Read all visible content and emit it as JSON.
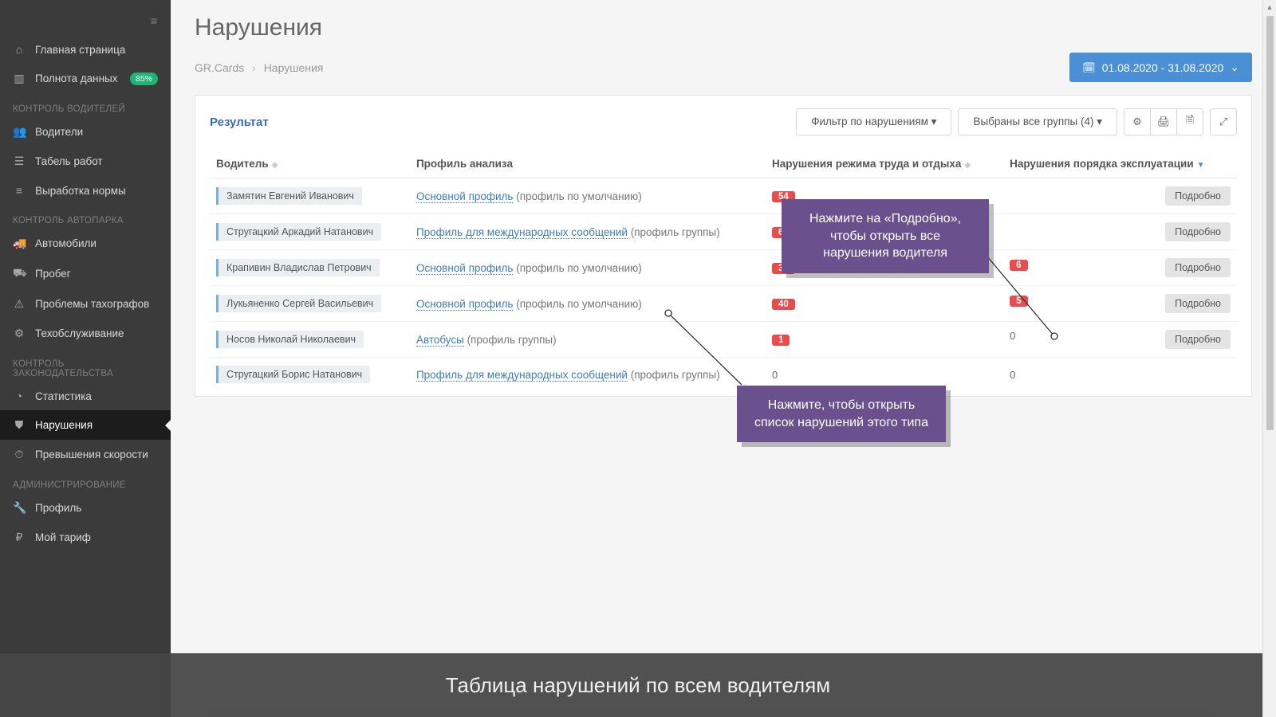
{
  "sidebar": {
    "items": [
      {
        "icon": "⌂",
        "label": "Главная страница"
      },
      {
        "icon": "▥",
        "label": "Полнота данных",
        "badge": "85%"
      }
    ],
    "groups": [
      {
        "title": "КОНТРОЛЬ ВОДИТЕЛЕЙ",
        "items": [
          {
            "icon": "👥",
            "label": "Водители"
          },
          {
            "icon": "☰",
            "label": "Табель работ"
          },
          {
            "icon": "≡",
            "label": "Выработка нормы"
          }
        ]
      },
      {
        "title": "КОНТРОЛЬ АВТОПАРКА",
        "items": [
          {
            "icon": "🚚",
            "label": "Автомобили"
          },
          {
            "icon": "⛟",
            "label": "Пробег"
          },
          {
            "icon": "⚠",
            "label": "Проблемы тахографов"
          },
          {
            "icon": "⚙",
            "label": "Техобслуживание"
          }
        ]
      },
      {
        "title": "КОНТРОЛЬ ЗАКОНОДАТЕЛЬСТВА",
        "items": [
          {
            "icon": "◔",
            "label": "Статистика"
          },
          {
            "icon": "⛊",
            "label": "Нарушения",
            "active": true
          },
          {
            "icon": "⏱",
            "label": "Превышения скорости"
          }
        ]
      },
      {
        "title": "АДМИНИСТРИРОВАНИЕ",
        "items": [
          {
            "icon": "🔧",
            "label": "Профиль"
          },
          {
            "icon": "₽",
            "label": "Мой тариф"
          }
        ]
      }
    ]
  },
  "page": {
    "title": "Нарушения",
    "breadcrumb_root": "GR.Cards",
    "breadcrumb_current": "Нарушения",
    "date_range": "01.08.2020 -  31.08.2020"
  },
  "panel": {
    "title": "Результат",
    "filter_btn": "Фильтр по нарушениям",
    "groups_btn": "Выбраны все группы (4)"
  },
  "table": {
    "headers": {
      "driver": "Водитель",
      "profile": "Профиль анализа",
      "violations_work": "Нарушения режима труда и отдыха",
      "violations_exp": "Нарушения порядка эксплуатации"
    },
    "rows": [
      {
        "driver": "Замятин Евгений Иванович",
        "profile_link": "Основной профиль",
        "profile_suffix": " (профиль по умолчанию)",
        "v1": "54",
        "v2": "",
        "detail": "Подробно"
      },
      {
        "driver": "Стругацкий Аркадий Натанович",
        "profile_link": "Профиль для международных сообщений",
        "profile_suffix": " (профиль группы)",
        "v1": "6",
        "v2": "",
        "detail": "Подробно"
      },
      {
        "driver": "Крапивин Владислав Петрович",
        "profile_link": "Основной профиль",
        "profile_suffix": " (профиль по умолчанию)",
        "v1": "30",
        "v2": "6",
        "detail": "Подробно"
      },
      {
        "driver": "Лукьяненко Сергей Васильевич",
        "profile_link": "Основной профиль",
        "profile_suffix": " (профиль по умолчанию)",
        "v1": "40",
        "v2": "5",
        "detail": "Подробно"
      },
      {
        "driver": "Носов Николай Николаевич",
        "profile_link": "Автобусы",
        "profile_suffix": " (профиль группы)",
        "v1": "1",
        "v2": "0",
        "detail": "Подробно"
      },
      {
        "driver": "Стругацкий Борис Натанович",
        "profile_link": "Профиль для международных сообщений",
        "profile_suffix": " (профиль группы)",
        "v1": "0",
        "v2": "0",
        "detail": ""
      }
    ]
  },
  "callouts": {
    "c1": "Нажмите на «Подробно», чтобы открыть все нарушения водителя",
    "c2": "Нажмите, чтобы открыть список нарушений этого типа"
  },
  "caption": "Таблица нарушений по всем водителям"
}
